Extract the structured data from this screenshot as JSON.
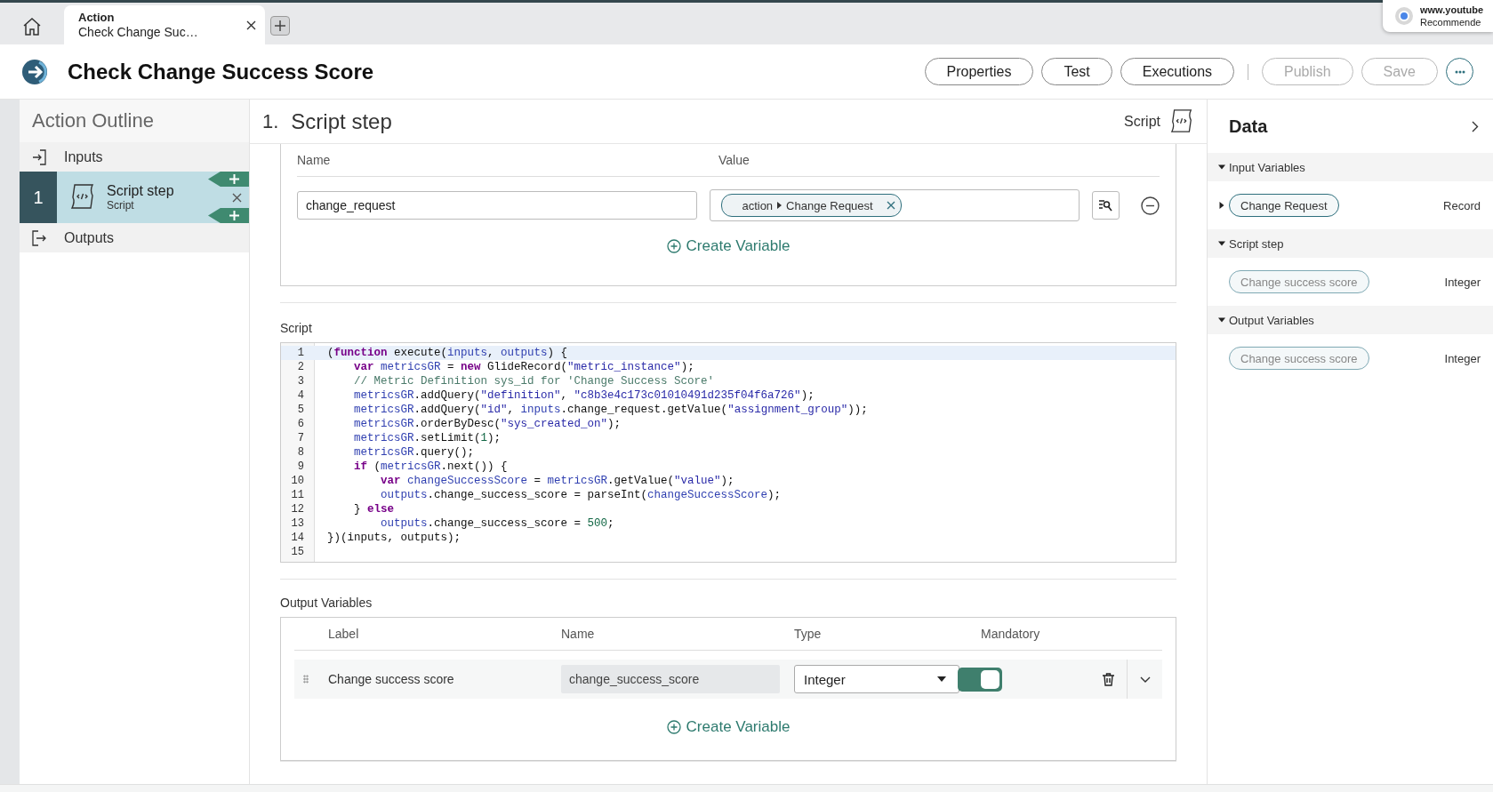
{
  "browser_tabs": [
    {
      "title": "Action",
      "subtitle": "Check Change Suc…",
      "selected": true
    }
  ],
  "notification": {
    "lines": [
      "www.youtube",
      "Recommende"
    ]
  },
  "header": {
    "title": "Check Change Success Score",
    "buttons": [
      {
        "label": "Properties",
        "disabled": false
      },
      {
        "label": "Test",
        "disabled": false
      },
      {
        "label": "Executions",
        "disabled": false
      },
      {
        "label": "Publish",
        "disabled": true
      },
      {
        "label": "Save",
        "disabled": true
      }
    ]
  },
  "outline": {
    "title": "Action Outline",
    "items": [
      {
        "kind": "inputs",
        "label": "Inputs",
        "selected": false
      },
      {
        "kind": "step",
        "number": "1",
        "label": "Script step",
        "sublabel": "Script",
        "selected": true
      },
      {
        "kind": "outputs",
        "label": "Outputs",
        "selected": false
      }
    ]
  },
  "step": {
    "number": "1.",
    "title": "Script step",
    "type_label": "Script"
  },
  "inputs_table": {
    "columns": [
      "Name",
      "Value"
    ],
    "rows": [
      {
        "name": "change_request",
        "pill": [
          "action",
          "Change Request"
        ]
      }
    ],
    "create": "Create Variable"
  },
  "script": {
    "label": "Script",
    "lines": [
      {
        "number": "1",
        "active": true,
        "tokens": [
          {
            "kind": "p",
            "text": "("
          },
          {
            "kind": "kw",
            "text": "function"
          },
          {
            "kind": "p",
            "text": " execute("
          },
          {
            "kind": "v",
            "text": "inputs"
          },
          {
            "kind": "p",
            "text": ", "
          },
          {
            "kind": "v",
            "text": "outputs"
          },
          {
            "kind": "p",
            "text": ") {"
          }
        ]
      },
      {
        "number": "2",
        "active": false,
        "tokens": [
          {
            "kind": "kw",
            "text": "    var "
          },
          {
            "kind": "v",
            "text": "metricsGR"
          },
          {
            "kind": "p",
            "text": " = "
          },
          {
            "kind": "kw",
            "text": "new"
          },
          {
            "kind": "p",
            "text": " GlideRecord("
          },
          {
            "kind": "s",
            "text": "\"metric_instance\""
          },
          {
            "kind": "p",
            "text": ");"
          }
        ]
      },
      {
        "number": "3",
        "active": false,
        "tokens": [
          {
            "kind": "c",
            "text": "    // Metric Definition sys_id for 'Change Success Score'"
          }
        ]
      },
      {
        "number": "4",
        "active": false,
        "tokens": [
          {
            "kind": "v",
            "text": "    metricsGR"
          },
          {
            "kind": "p",
            "text": ".addQuery("
          },
          {
            "kind": "s",
            "text": "\"definition\""
          },
          {
            "kind": "p",
            "text": ", "
          },
          {
            "kind": "s",
            "text": "\"c8b3e4c173c01010491d235f04f6a726\""
          },
          {
            "kind": "p",
            "text": ");"
          }
        ]
      },
      {
        "number": "5",
        "active": false,
        "tokens": [
          {
            "kind": "v",
            "text": "    metricsGR"
          },
          {
            "kind": "p",
            "text": ".addQuery("
          },
          {
            "kind": "s",
            "text": "\"id\""
          },
          {
            "kind": "p",
            "text": ", "
          },
          {
            "kind": "v",
            "text": "inputs"
          },
          {
            "kind": "p",
            "text": ".change_request.getValue("
          },
          {
            "kind": "s",
            "text": "\"assignment_group\""
          },
          {
            "kind": "p",
            "text": "));"
          }
        ]
      },
      {
        "number": "6",
        "active": false,
        "tokens": [
          {
            "kind": "v",
            "text": "    metricsGR"
          },
          {
            "kind": "p",
            "text": ".orderByDesc("
          },
          {
            "kind": "s",
            "text": "\"sys_created_on\""
          },
          {
            "kind": "p",
            "text": ");"
          }
        ]
      },
      {
        "number": "7",
        "active": false,
        "tokens": [
          {
            "kind": "v",
            "text": "    metricsGR"
          },
          {
            "kind": "p",
            "text": ".setLimit("
          },
          {
            "kind": "n",
            "text": "1"
          },
          {
            "kind": "p",
            "text": ");"
          }
        ]
      },
      {
        "number": "8",
        "active": false,
        "tokens": [
          {
            "kind": "v",
            "text": "    metricsGR"
          },
          {
            "kind": "p",
            "text": ".query();"
          }
        ]
      },
      {
        "number": "9",
        "active": false,
        "tokens": [
          {
            "kind": "kw",
            "text": "    if"
          },
          {
            "kind": "p",
            "text": " ("
          },
          {
            "kind": "v",
            "text": "metricsGR"
          },
          {
            "kind": "p",
            "text": ".next()) {"
          }
        ]
      },
      {
        "number": "10",
        "active": false,
        "tokens": [
          {
            "kind": "kw",
            "text": "        var "
          },
          {
            "kind": "v",
            "text": "changeSuccessScore"
          },
          {
            "kind": "p",
            "text": " = "
          },
          {
            "kind": "v",
            "text": "metricsGR"
          },
          {
            "kind": "p",
            "text": ".getValue("
          },
          {
            "kind": "s",
            "text": "\"value\""
          },
          {
            "kind": "p",
            "text": ");"
          }
        ]
      },
      {
        "number": "11",
        "active": false,
        "tokens": [
          {
            "kind": "v",
            "text": "        outputs"
          },
          {
            "kind": "p",
            "text": ".change_success_score = parseInt("
          },
          {
            "kind": "v",
            "text": "changeSuccessScore"
          },
          {
            "kind": "p",
            "text": ");"
          }
        ]
      },
      {
        "number": "12",
        "active": false,
        "tokens": [
          {
            "kind": "p",
            "text": "    } "
          },
          {
            "kind": "kw",
            "text": "else"
          }
        ]
      },
      {
        "number": "13",
        "active": false,
        "tokens": [
          {
            "kind": "v",
            "text": "        outputs"
          },
          {
            "kind": "p",
            "text": ".change_success_score = "
          },
          {
            "kind": "n",
            "text": "500"
          },
          {
            "kind": "p",
            "text": ";"
          }
        ]
      },
      {
        "number": "14",
        "active": false,
        "tokens": [
          {
            "kind": "p",
            "text": "})(inputs, outputs);"
          }
        ]
      },
      {
        "number": "15",
        "active": false
      }
    ]
  },
  "outputs": {
    "label": "Output Variables",
    "columns": [
      "Label",
      "Name",
      "Type",
      "Mandatory"
    ],
    "rows": [
      {
        "label": "Change success score",
        "name": "change_success_score",
        "type": "Integer",
        "mandatory": true
      }
    ],
    "create": "Create Variable"
  },
  "data_panel": {
    "title": "Data",
    "sections": [
      {
        "title": "Input Variables",
        "expanded": true,
        "items": [
          {
            "label": "Change Request",
            "type": "Record",
            "kind": "record",
            "expandable": true
          }
        ]
      },
      {
        "title": "Script step",
        "expanded": true,
        "items": [
          {
            "label": "Change success score",
            "type": "Integer",
            "kind": "value",
            "expandable": false
          }
        ]
      },
      {
        "title": "Output Variables",
        "expanded": true,
        "items": [
          {
            "label": "Change success score",
            "type": "Integer",
            "kind": "value",
            "expandable": false
          }
        ]
      }
    ]
  }
}
